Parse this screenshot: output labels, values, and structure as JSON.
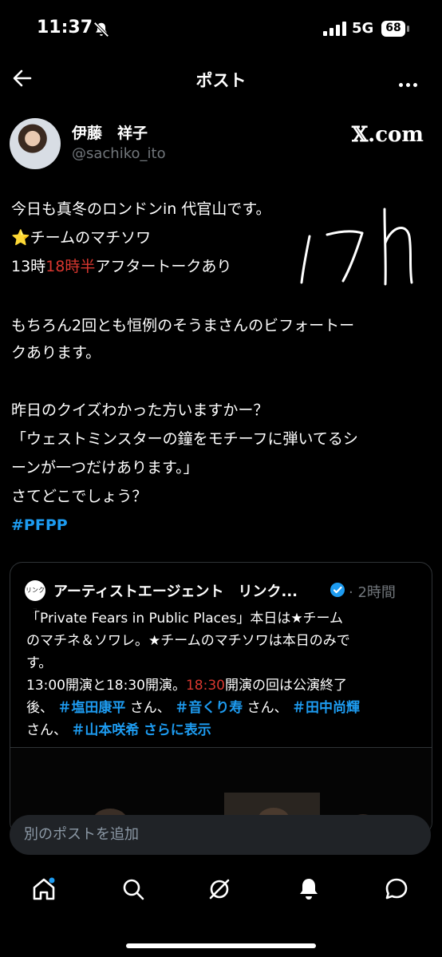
{
  "status_bar": {
    "time": "11:37",
    "network": "5G",
    "battery": "68"
  },
  "header": {
    "title": "ポスト"
  },
  "author": {
    "name": "伊藤　祥子",
    "handle": "@sachiko_ito",
    "source": "𝕏.com"
  },
  "post": {
    "line1": "今日も真冬のロンドンin 代官山です。",
    "line2_emoji": "⭐",
    "line2_text": "チームのマチソワ",
    "line3_a": "13時",
    "line3_b": "18時半",
    "line3_c": "アフタートークあり",
    "para2_l1": "もちろん2回とも恒例のそうまさんのビフォートー",
    "para2_l2": "クあります。",
    "para3_l1": "昨日のクイズわかった方いますかー？",
    "para3_l2": "「ウェストミンスターの鐘をモチーフに弾いてるシ",
    "para3_l3": "ーンが一つだけあります。」",
    "para3_l4": "さてどこでしょう？",
    "hashtag": "#PFPP"
  },
  "quote": {
    "avatar_text": "リンクス",
    "author": "アーティストエージェント　リンク...",
    "time": "· 2時間",
    "l1": "「Private Fears in Public Places」本日は★チーム",
    "l2": "のマチネ＆ソワレ。★チームのマチソワは本日のみで",
    "l3": "す。",
    "l4a": "13:00開演と18:30開演。",
    "l4b": "18:30",
    "l4c": "開演の回は公演終了",
    "l5a": "後、",
    "l5b": "＃塩田康平",
    "l5c": "さん、",
    "l5d": "＃音くり寿",
    "l5e": "さん、",
    "l5f": "＃田中尚輝",
    "l6a": "さん、",
    "l6b": "＃山本咲希",
    "l6c": "さらに表示"
  },
  "compose": {
    "placeholder": "別のポストを追加"
  },
  "tabs": [
    "home-icon",
    "search-icon",
    "grok-icon",
    "notifications-icon",
    "messages-icon"
  ],
  "colors": {
    "accent": "#1d9bf0",
    "background": "#000000",
    "annotation_red": "#d9372f"
  }
}
